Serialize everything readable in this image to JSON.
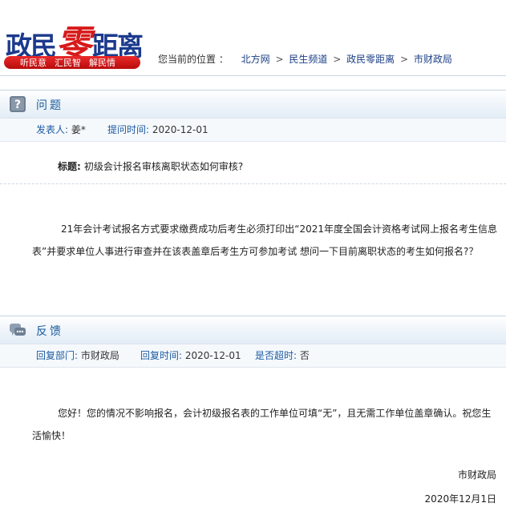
{
  "header": {
    "logo_part1": "政民",
    "logo_part2": "零",
    "logo_part3": "距离",
    "slogans": [
      "听民意",
      "汇民智",
      "解民情"
    ]
  },
  "breadcrumb": {
    "prefix": "您当前的位置 ：",
    "items": [
      "北方网",
      "民生频道",
      "政民零距离",
      "市财政局"
    ],
    "separator": ">"
  },
  "question": {
    "section_title": "问题",
    "poster_label": "发表人:",
    "poster_value": "姜*",
    "time_label": "提问时间:",
    "time_value": "2020-12-01",
    "title_label": "标题:",
    "title_text": "初级会计报名审核离职状态如何审核?",
    "body": "21年会计考试报名方式要求缴费成功后考生必须打印出“2021年度全国会计资格考试网上报名考生信息表”并要求单位人事进行审查并在该表盖章后考生方可参加考试 想问一下目前离职状态的考生如何报名?？"
  },
  "answer": {
    "section_title": "反馈",
    "dept_label": "回复部门:",
    "dept_value": "市财政局",
    "time_label": "回复时间:",
    "time_value": "2020-12-01",
    "overdue_label": "是否超时:",
    "overdue_value": "否",
    "body": "您好！您的情况不影响报名，会计初级报名表的工作单位可填“无”，且无需工作单位盖章确认。祝您生活愉快！",
    "signature": "市财政局",
    "date": "2020年12月1日"
  },
  "colors": {
    "brand_blue": "#1b3a8c",
    "brand_red": "#d71a1a",
    "link_blue": "#1b5aa2"
  }
}
